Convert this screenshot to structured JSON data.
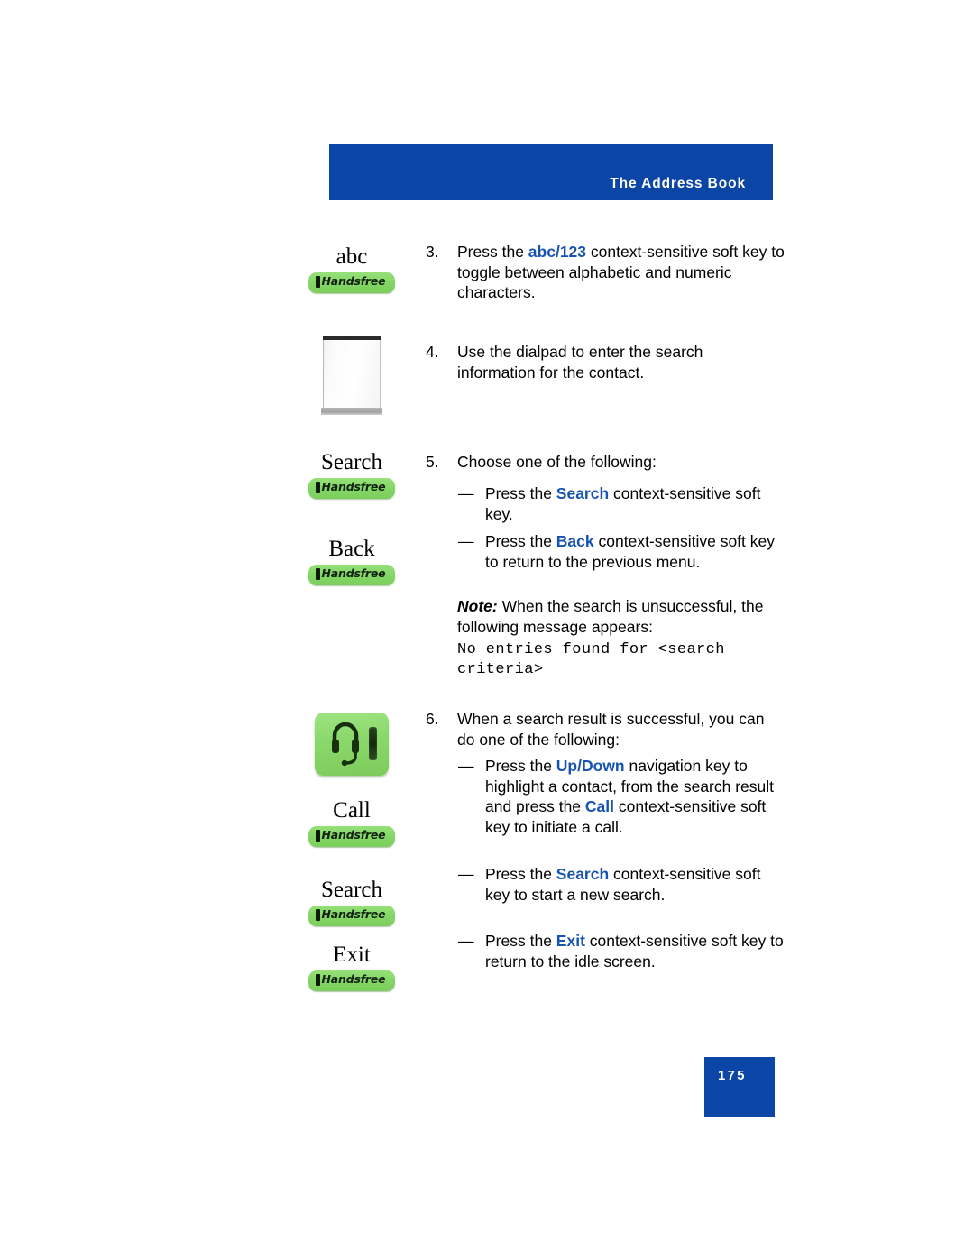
{
  "header": {
    "title": "The Address Book",
    "bar_color": "#0b45a6"
  },
  "accent_color": "#1753b0",
  "left_column": {
    "items": [
      {
        "label": "abc",
        "graphic": "handsfree-softkey",
        "handsfree_text": "Handsfree"
      },
      {
        "label": "",
        "graphic": "dialpad-key",
        "handsfree_text": ""
      },
      {
        "label": "Search",
        "graphic": "handsfree-softkey",
        "handsfree_text": "Handsfree"
      },
      {
        "label": "Back",
        "graphic": "handsfree-softkey",
        "handsfree_text": "Handsfree"
      },
      {
        "label": "",
        "graphic": "navigation-key",
        "handsfree_text": ""
      },
      {
        "label": "Call",
        "graphic": "handsfree-softkey",
        "handsfree_text": "Handsfree"
      },
      {
        "label": "Search",
        "graphic": "handsfree-softkey",
        "handsfree_text": "Handsfree"
      },
      {
        "label": "Exit",
        "graphic": "handsfree-softkey",
        "handsfree_text": "Handsfree"
      }
    ]
  },
  "steps": {
    "step3": {
      "number": "3.",
      "text_before": "Press the ",
      "keyword": "abc/123",
      "text_after": " context-sensitive soft key to toggle between alphabetic and numeric characters."
    },
    "step4": {
      "number": "4.",
      "text": "Use the dialpad to enter the search information for the contact."
    },
    "step5": {
      "number": "5.",
      "text": "Choose one of the following:"
    },
    "step5_bullet1": {
      "dash": "—",
      "text_before": "Press the ",
      "keyword": "Search",
      "text_after": " context-sensitive soft key."
    },
    "step5_bullet2": {
      "dash": "—",
      "text_before": "Press the ",
      "keyword": "Back",
      "text_after": " context-sensitive soft key to return to the previous menu."
    },
    "note": {
      "lead": "Note:",
      "text": " When the search is unsuccessful, the following message appears:",
      "message": "No entries found for <search criteria>"
    },
    "step6": {
      "number": "6.",
      "text": "When a search result is successful, you can do one of the following:"
    },
    "step6_bullet1": {
      "dash": "—",
      "text_before": "Press the ",
      "keyword1": "Up/Down",
      "text_middle": " navigation key to highlight a contact, from the search result and press the ",
      "keyword2": "Call",
      "text_after": " context-sensitive soft key to initiate a call."
    },
    "step6_bullet2": {
      "dash": "—",
      "text_before": "Press the ",
      "keyword": "Search",
      "text_after": " context-sensitive soft key to start a new search."
    },
    "step6_bullet3": {
      "dash": "—",
      "text_before": "Press the ",
      "keyword": "Exit",
      "text_after": " context-sensitive soft key to return to the idle screen."
    }
  },
  "footer": {
    "page_number": "175"
  }
}
